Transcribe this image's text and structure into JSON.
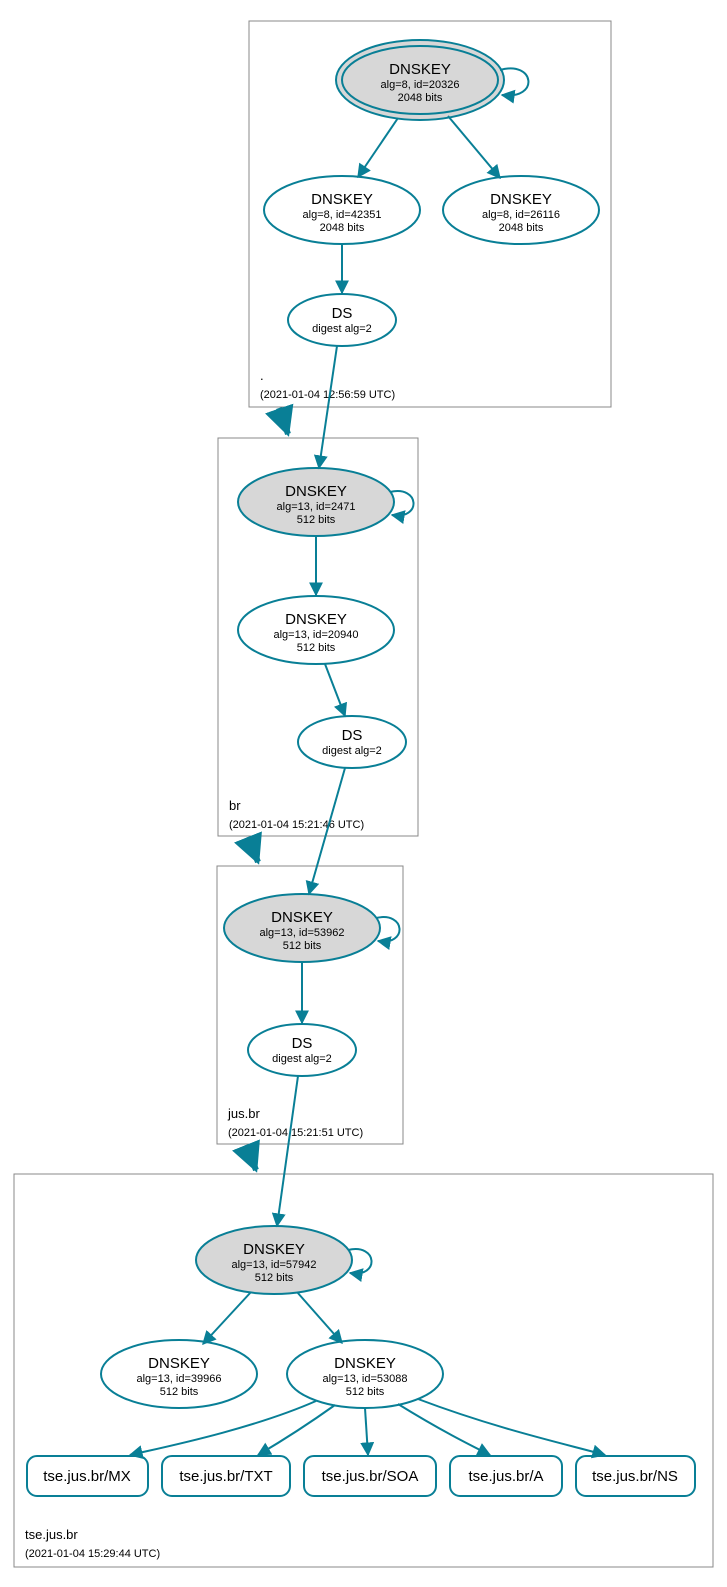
{
  "zones": {
    "root": {
      "label": ".",
      "ts": "(2021-01-04 12:56:59 UTC)"
    },
    "br": {
      "label": "br",
      "ts": "(2021-01-04 15:21:46 UTC)"
    },
    "jusbr": {
      "label": "jus.br",
      "ts": "(2021-01-04 15:21:51 UTC)"
    },
    "tse": {
      "label": "tse.jus.br",
      "ts": "(2021-01-04 15:29:44 UTC)"
    }
  },
  "nodes": {
    "root_ksk": {
      "t": "DNSKEY",
      "l1": "alg=8, id=20326",
      "l2": "2048 bits"
    },
    "root_zsk1": {
      "t": "DNSKEY",
      "l1": "alg=8, id=42351",
      "l2": "2048 bits"
    },
    "root_zsk2": {
      "t": "DNSKEY",
      "l1": "alg=8, id=26116",
      "l2": "2048 bits"
    },
    "root_ds": {
      "t": "DS",
      "l1": "digest alg=2",
      "l2": ""
    },
    "br_ksk": {
      "t": "DNSKEY",
      "l1": "alg=13, id=2471",
      "l2": "512 bits"
    },
    "br_zsk": {
      "t": "DNSKEY",
      "l1": "alg=13, id=20940",
      "l2": "512 bits"
    },
    "br_ds": {
      "t": "DS",
      "l1": "digest alg=2",
      "l2": ""
    },
    "jus_ksk": {
      "t": "DNSKEY",
      "l1": "alg=13, id=53962",
      "l2": "512 bits"
    },
    "jus_ds": {
      "t": "DS",
      "l1": "digest alg=2",
      "l2": ""
    },
    "tse_ksk": {
      "t": "DNSKEY",
      "l1": "alg=13, id=57942",
      "l2": "512 bits"
    },
    "tse_zsk1": {
      "t": "DNSKEY",
      "l1": "alg=13, id=39966",
      "l2": "512 bits"
    },
    "tse_zsk2": {
      "t": "DNSKEY",
      "l1": "alg=13, id=53088",
      "l2": "512 bits"
    }
  },
  "rr": {
    "mx": "tse.jus.br/MX",
    "txt": "tse.jus.br/TXT",
    "soa": "tse.jus.br/SOA",
    "a": "tse.jus.br/A",
    "ns": "tse.jus.br/NS"
  },
  "chart_data": {
    "type": "diagram",
    "title": "DNSSEC authentication chain",
    "zones": [
      {
        "name": ".",
        "timestamp": "2021-01-04 12:56:59 UTC"
      },
      {
        "name": "br",
        "timestamp": "2021-01-04 15:21:46 UTC"
      },
      {
        "name": "jus.br",
        "timestamp": "2021-01-04 15:21:51 UTC"
      },
      {
        "name": "tse.jus.br",
        "timestamp": "2021-01-04 15:29:44 UTC"
      }
    ],
    "nodes": [
      {
        "id": "root_ksk",
        "zone": ".",
        "type": "DNSKEY",
        "alg": 8,
        "keyid": 20326,
        "bits": 2048,
        "sep": true
      },
      {
        "id": "root_zsk1",
        "zone": ".",
        "type": "DNSKEY",
        "alg": 8,
        "keyid": 42351,
        "bits": 2048
      },
      {
        "id": "root_zsk2",
        "zone": ".",
        "type": "DNSKEY",
        "alg": 8,
        "keyid": 26116,
        "bits": 2048
      },
      {
        "id": "root_ds",
        "zone": ".",
        "type": "DS",
        "digest_alg": 2
      },
      {
        "id": "br_ksk",
        "zone": "br",
        "type": "DNSKEY",
        "alg": 13,
        "keyid": 2471,
        "bits": 512,
        "sep": true
      },
      {
        "id": "br_zsk",
        "zone": "br",
        "type": "DNSKEY",
        "alg": 13,
        "keyid": 20940,
        "bits": 512
      },
      {
        "id": "br_ds",
        "zone": "br",
        "type": "DS",
        "digest_alg": 2
      },
      {
        "id": "jus_ksk",
        "zone": "jus.br",
        "type": "DNSKEY",
        "alg": 13,
        "keyid": 53962,
        "bits": 512,
        "sep": true
      },
      {
        "id": "jus_ds",
        "zone": "jus.br",
        "type": "DS",
        "digest_alg": 2
      },
      {
        "id": "tse_ksk",
        "zone": "tse.jus.br",
        "type": "DNSKEY",
        "alg": 13,
        "keyid": 57942,
        "bits": 512,
        "sep": true
      },
      {
        "id": "tse_zsk1",
        "zone": "tse.jus.br",
        "type": "DNSKEY",
        "alg": 13,
        "keyid": 39966,
        "bits": 512
      },
      {
        "id": "tse_zsk2",
        "zone": "tse.jus.br",
        "type": "DNSKEY",
        "alg": 13,
        "keyid": 53088,
        "bits": 512
      },
      {
        "id": "rr_mx",
        "zone": "tse.jus.br",
        "type": "RRset",
        "name": "tse.jus.br/MX"
      },
      {
        "id": "rr_txt",
        "zone": "tse.jus.br",
        "type": "RRset",
        "name": "tse.jus.br/TXT"
      },
      {
        "id": "rr_soa",
        "zone": "tse.jus.br",
        "type": "RRset",
        "name": "tse.jus.br/SOA"
      },
      {
        "id": "rr_a",
        "zone": "tse.jus.br",
        "type": "RRset",
        "name": "tse.jus.br/A"
      },
      {
        "id": "rr_ns",
        "zone": "tse.jus.br",
        "type": "RRset",
        "name": "tse.jus.br/NS"
      }
    ],
    "edges": [
      {
        "from": "root_ksk",
        "to": "root_ksk"
      },
      {
        "from": "root_ksk",
        "to": "root_zsk1"
      },
      {
        "from": "root_ksk",
        "to": "root_zsk2"
      },
      {
        "from": "root_zsk1",
        "to": "root_ds"
      },
      {
        "from": "root_ds",
        "to": "br_ksk"
      },
      {
        "from": "br_ksk",
        "to": "br_ksk"
      },
      {
        "from": "br_ksk",
        "to": "br_zsk"
      },
      {
        "from": "br_zsk",
        "to": "br_ds"
      },
      {
        "from": "br_ds",
        "to": "jus_ksk"
      },
      {
        "from": "jus_ksk",
        "to": "jus_ksk"
      },
      {
        "from": "jus_ksk",
        "to": "jus_ds"
      },
      {
        "from": "jus_ds",
        "to": "tse_ksk"
      },
      {
        "from": "tse_ksk",
        "to": "tse_ksk"
      },
      {
        "from": "tse_ksk",
        "to": "tse_zsk1"
      },
      {
        "from": "tse_ksk",
        "to": "tse_zsk2"
      },
      {
        "from": "tse_zsk2",
        "to": "rr_mx"
      },
      {
        "from": "tse_zsk2",
        "to": "rr_txt"
      },
      {
        "from": "tse_zsk2",
        "to": "rr_soa"
      },
      {
        "from": "tse_zsk2",
        "to": "rr_a"
      },
      {
        "from": "tse_zsk2",
        "to": "rr_ns"
      }
    ]
  }
}
